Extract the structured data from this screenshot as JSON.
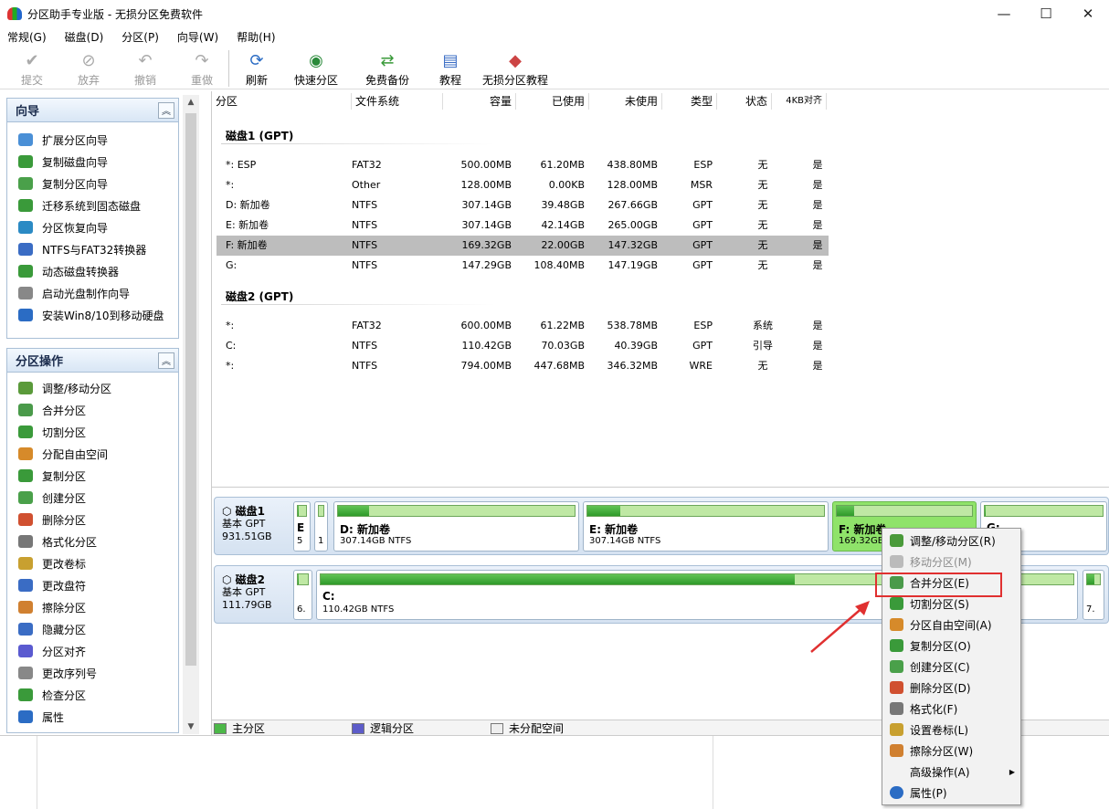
{
  "window": {
    "title": "分区助手专业版 - 无损分区免费软件",
    "minimize": "—",
    "maximize": "☐",
    "close": "✕"
  },
  "menu": [
    "常规(G)",
    "磁盘(D)",
    "分区(P)",
    "向导(W)",
    "帮助(H)"
  ],
  "toolbar": {
    "submit": "提交",
    "discard": "放弃",
    "undo": "撤销",
    "redo": "重做",
    "refresh": "刷新",
    "quick_partition": "快速分区",
    "free_backup": "免费备份",
    "tutorial": "教程",
    "lossless_tutorial": "无损分区教程"
  },
  "wizard_panel": {
    "title": "向导",
    "items": [
      "扩展分区向导",
      "复制磁盘向导",
      "复制分区向导",
      "迁移系统到固态磁盘",
      "分区恢复向导",
      "NTFS与FAT32转换器",
      "动态磁盘转换器",
      "启动光盘制作向导",
      "安装Win8/10到移动硬盘"
    ]
  },
  "ops_panel": {
    "title": "分区操作",
    "items": [
      "调整/移动分区",
      "合并分区",
      "切割分区",
      "分配自由空间",
      "复制分区",
      "创建分区",
      "删除分区",
      "格式化分区",
      "更改卷标",
      "更改盘符",
      "擦除分区",
      "隐藏分区",
      "分区对齐",
      "更改序列号",
      "检查分区",
      "属性"
    ]
  },
  "columns": [
    "分区",
    "文件系统",
    "容量",
    "已使用",
    "未使用",
    "类型",
    "状态",
    "4KB对齐"
  ],
  "disk1": {
    "title": "磁盘1 (GPT)",
    "rows": [
      [
        "*: ESP",
        "FAT32",
        "500.00MB",
        "61.20MB",
        "438.80MB",
        "ESP",
        "无",
        "是"
      ],
      [
        "*:",
        "Other",
        "128.00MB",
        "0.00KB",
        "128.00MB",
        "MSR",
        "无",
        "是"
      ],
      [
        "D: 新加卷",
        "NTFS",
        "307.14GB",
        "39.48GB",
        "267.66GB",
        "GPT",
        "无",
        "是"
      ],
      [
        "E: 新加卷",
        "NTFS",
        "307.14GB",
        "42.14GB",
        "265.00GB",
        "GPT",
        "无",
        "是"
      ],
      [
        "F: 新加卷",
        "NTFS",
        "169.32GB",
        "22.00GB",
        "147.32GB",
        "GPT",
        "无",
        "是"
      ],
      [
        "G:",
        "NTFS",
        "147.29GB",
        "108.40MB",
        "147.19GB",
        "GPT",
        "无",
        "是"
      ]
    ]
  },
  "disk2": {
    "title": "磁盘2 (GPT)",
    "rows": [
      [
        "*:",
        "FAT32",
        "600.00MB",
        "61.22MB",
        "538.78MB",
        "ESP",
        "系统",
        "是"
      ],
      [
        "C:",
        "NTFS",
        "110.42GB",
        "70.03GB",
        "40.39GB",
        "GPT",
        "引导",
        "是"
      ],
      [
        "*:",
        "NTFS",
        "794.00MB",
        "447.68MB",
        "346.32MB",
        "WRE",
        "无",
        "是"
      ]
    ]
  },
  "diskmap1": {
    "name": "磁盘1",
    "type": "基本 GPT",
    "size": "931.51GB",
    "segments": [
      {
        "name": "E",
        "size": "5",
        "used": 0.12
      },
      {
        "name": "",
        "size": "1",
        "used": 0
      },
      {
        "name": "D: 新加卷",
        "size": "307.14GB NTFS",
        "used": 0.13
      },
      {
        "name": "E: 新加卷",
        "size": "307.14GB NTFS",
        "used": 0.14
      },
      {
        "name": "F: 新加卷",
        "size": "169.32GB",
        "used": 0.13
      },
      {
        "name": "G:",
        "size": "B NTFS",
        "used": 0.01
      }
    ]
  },
  "diskmap2": {
    "name": "磁盘2",
    "type": "基本 GPT",
    "size": "111.79GB",
    "segments": [
      {
        "name": "",
        "size": "6.",
        "used": 0.1
      },
      {
        "name": "C:",
        "size": "110.42GB NTFS",
        "used": 0.63
      },
      {
        "name": "",
        "size": "7.",
        "used": 0.56
      }
    ]
  },
  "legend": [
    "主分区",
    "逻辑分区",
    "未分配空间"
  ],
  "context_menu": [
    "调整/移动分区(R)",
    "移动分区(M)",
    "合并分区(E)",
    "切割分区(S)",
    "分区自由空间(A)",
    "复制分区(O)",
    "创建分区(C)",
    "删除分区(D)",
    "格式化(F)",
    "设置卷标(L)",
    "擦除分区(W)",
    "高级操作(A)",
    "属性(P)"
  ],
  "colors": {
    "accent": "#2f9a2a",
    "selection": "#8fe36a",
    "highlight_box": "#e03030",
    "panel_border": "#a9bfd6"
  }
}
